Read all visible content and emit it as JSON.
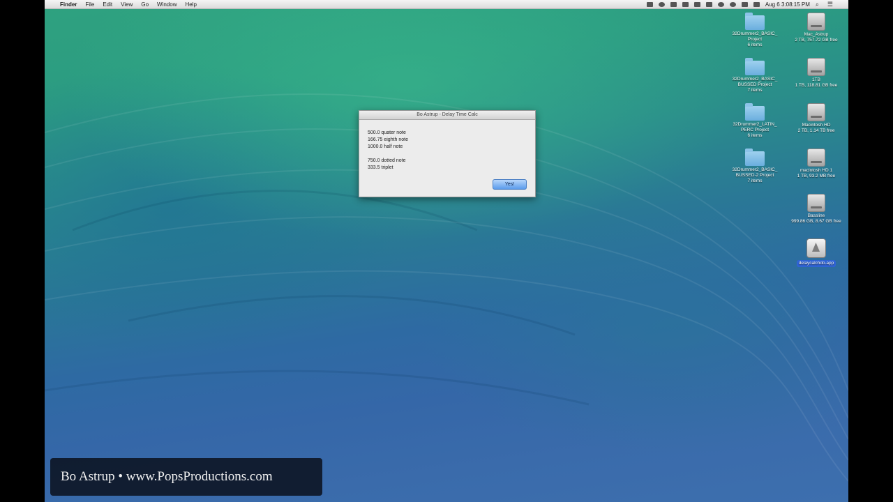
{
  "menubar": {
    "apple": "",
    "app_name": "Finder",
    "menus": [
      "File",
      "Edit",
      "View",
      "Go",
      "Window",
      "Help"
    ],
    "clock": "Aug 6  3:08:15 PM",
    "search_icon": "search-icon",
    "list_icon": "list-icon"
  },
  "dialog": {
    "title": "Bo Astrup - Delay Time Calc",
    "lines1": [
      "500.0 quater note",
      "166.75 eighth note",
      "1000.0 half note"
    ],
    "lines2": [
      "750.0 dotted note",
      "333.5 triplet"
    ],
    "button": "Yes!"
  },
  "desktop_icons": [
    {
      "type": "folder",
      "name": "32Drummer2_BASIC_",
      "name2": "Project",
      "sub": "6 items"
    },
    {
      "type": "disk",
      "name": "Mac_Astrup",
      "name2": "",
      "sub": "2 TB, 757.72 GB free"
    },
    {
      "type": "folder",
      "name": "32Drummer2_BASIC_",
      "name2": "BUSSED Project",
      "sub": "7 items"
    },
    {
      "type": "disk",
      "name": "1TB",
      "name2": "",
      "sub": "1 TB, 118.81 GB free"
    },
    {
      "type": "folder",
      "name": "32Drummer2_LATIN_",
      "name2": "PERC Project",
      "sub": "6 items"
    },
    {
      "type": "disk",
      "name": "Macintosh HD",
      "name2": "",
      "sub": "2 TB, 1.14 TB free"
    },
    {
      "type": "folder",
      "name": "32Drummer2_BASIC_",
      "name2": "BUSSED-2 Project",
      "sub": "7 items"
    },
    {
      "type": "disk",
      "name": "macintosh HD 1",
      "name2": "",
      "sub": "1 TB, 93.2 MB free"
    },
    {
      "type": "disk",
      "name": "Bassline",
      "name2": "",
      "sub": "999.86 GB, 8.67 GB free"
    },
    {
      "type": "app",
      "name": "delaycalchdo.app",
      "name2": "",
      "sub": ""
    }
  ],
  "banner": {
    "text": "Bo Astrup • www.PopsProductions.com"
  }
}
